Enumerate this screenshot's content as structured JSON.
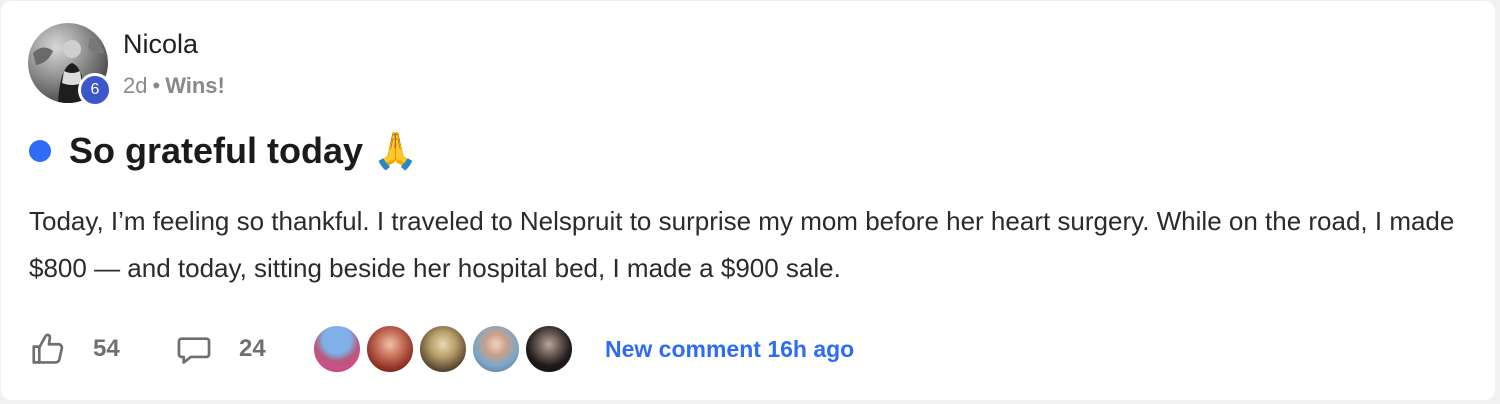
{
  "post": {
    "author": {
      "name": "Nicola",
      "level": "6"
    },
    "meta": {
      "time": "2d",
      "separator": "•",
      "category": "Wins!"
    },
    "title": "So grateful today 🙏",
    "body": "Today, I’m feeling so thankful. I traveled to Nelspruit to surprise my mom before her heart surgery. While on the road, I made $800 — and today, sitting beside her hospital bed, I made a $900 sale.",
    "likes": "54",
    "comments": "24",
    "new_comment_label": "New comment 16h ago"
  },
  "icons": {
    "like": "thumbs-up-icon",
    "comment": "speech-bubble-icon"
  },
  "colors": {
    "accent": "#2f6cf5",
    "level_badge": "#3b57c9",
    "unread_dot": "#2f6cf5"
  }
}
